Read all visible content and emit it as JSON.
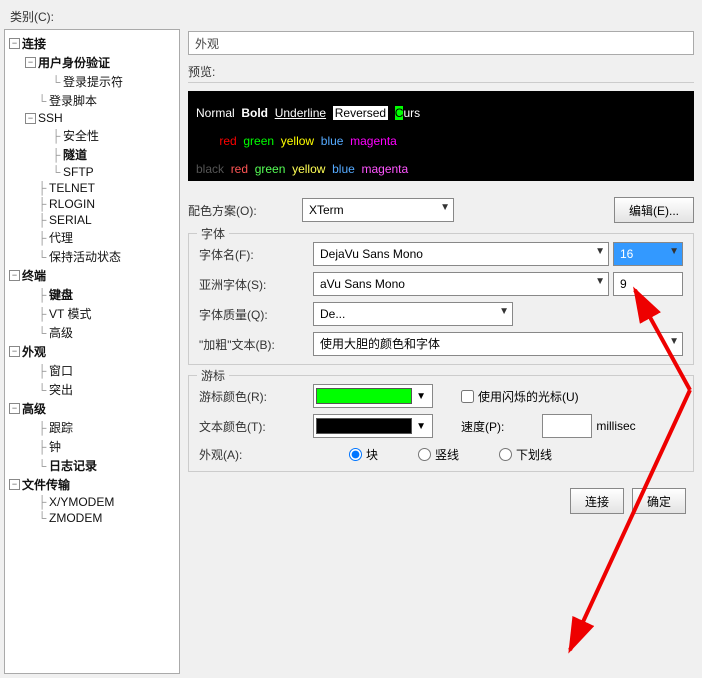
{
  "toplabel": "类别(C):",
  "tree": {
    "connection": "连接",
    "user_auth": "用户身份验证",
    "login_hint": "登录提示符",
    "login_script": "登录脚本",
    "ssh": "SSH",
    "security": "安全性",
    "tunnel": "隧道",
    "sftp": "SFTP",
    "telnet": "TELNET",
    "rlogin": "RLOGIN",
    "serial": "SERIAL",
    "proxy": "代理",
    "keepalive": "保持活动状态",
    "terminal": "终端",
    "keyboard": "键盘",
    "vt": "VT 模式",
    "advanced": "高级",
    "appearance": "外观",
    "window": "窗口",
    "highlight": "突出",
    "advanced2": "高级",
    "trace": "跟踪",
    "bell": "钟",
    "log": "日志记录",
    "file_transfer": "文件传输",
    "xymodem": "X/YMODEM",
    "zmodem": "ZMODEM"
  },
  "tabs": {
    "active": "外观"
  },
  "preview": {
    "label": "预览:",
    "r1": {
      "normal": "Normal",
      "bold": "Bold",
      "under": "Underline",
      "rev": "Reversed",
      "cur1": "C",
      "cur2": "urs"
    },
    "r2": {
      "red": "red",
      "green": "green",
      "yellow": "yellow",
      "blue": "blue",
      "magenta": "magenta"
    },
    "r3": {
      "black": "black",
      "red": "red",
      "green": "green",
      "yellow": "yellow",
      "blue": "blue",
      "magenta": "magenta"
    }
  },
  "scheme": {
    "label": "配色方案(O):",
    "value": "XTerm",
    "edit": "编辑(E)..."
  },
  "font": {
    "legend": "字体",
    "name_label": "字体名(F):",
    "name_value": "DejaVu Sans Mono",
    "size_value": "16",
    "asian_label": "亚洲字体(S):",
    "asian_value": "aVu Sans Mono",
    "asian_size": "9",
    "quality_label": "字体质量(Q):",
    "quality_value": "De...",
    "bold_label": "\"加粗\"文本(B):",
    "bold_value": "使用大胆的颜色和字体"
  },
  "cursor": {
    "legend": "游标",
    "color_label": "游标颜色(R):",
    "color_value": "#00ff00",
    "blink_label": "使用闪烁的光标(U)",
    "text_label": "文本颜色(T):",
    "text_value": "#000000",
    "speed_label": "速度(P):",
    "speed_value": "",
    "speed_unit": "millisec",
    "shape_label": "外观(A):",
    "shape_block": "块",
    "shape_vline": "竖线",
    "shape_uline": "下划线"
  },
  "footer": {
    "connect": "连接",
    "ok": "确定"
  }
}
